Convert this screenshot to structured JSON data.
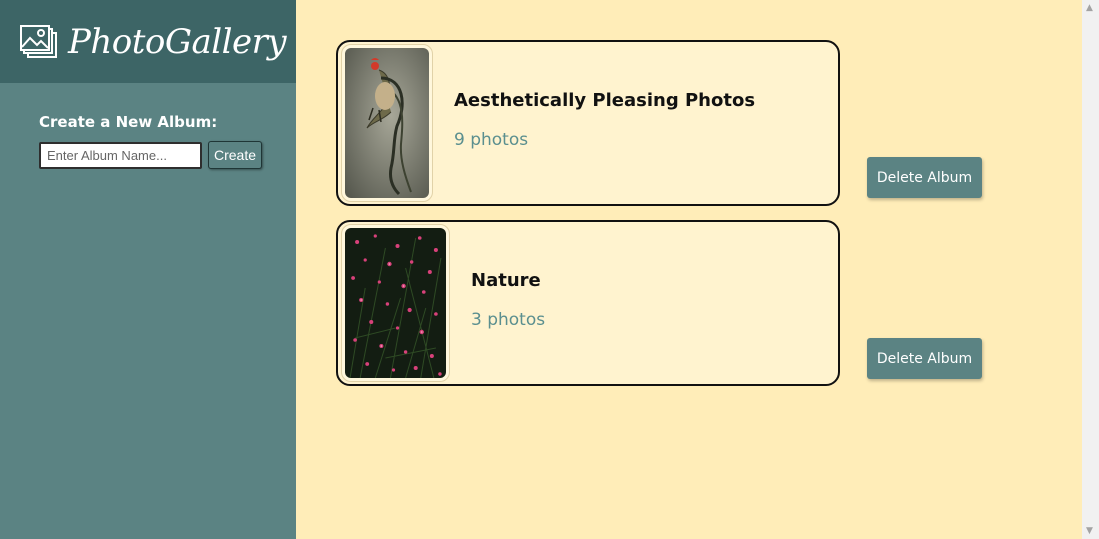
{
  "app": {
    "title": "PhotoGallery"
  },
  "sidebar": {
    "create_label": "Create a New Album:",
    "input_placeholder": "Enter Album Name...",
    "input_value": "",
    "create_button": "Create"
  },
  "albums": [
    {
      "title": "Aesthetically Pleasing Photos",
      "count": "9 photos",
      "delete_label": "Delete Album"
    },
    {
      "title": "Nature",
      "count": "3 photos",
      "delete_label": "Delete Album"
    }
  ],
  "colors": {
    "sidebar": "#5b8383",
    "sidebar_header": "#3d6566",
    "main_background": "#ffedb8",
    "card_background": "#fff3cf",
    "count_text": "#5b8f8f"
  },
  "icons": {
    "logo": "photo-gallery-icon",
    "scroll_up": "arrow-up-icon",
    "scroll_down": "arrow-down-icon"
  }
}
